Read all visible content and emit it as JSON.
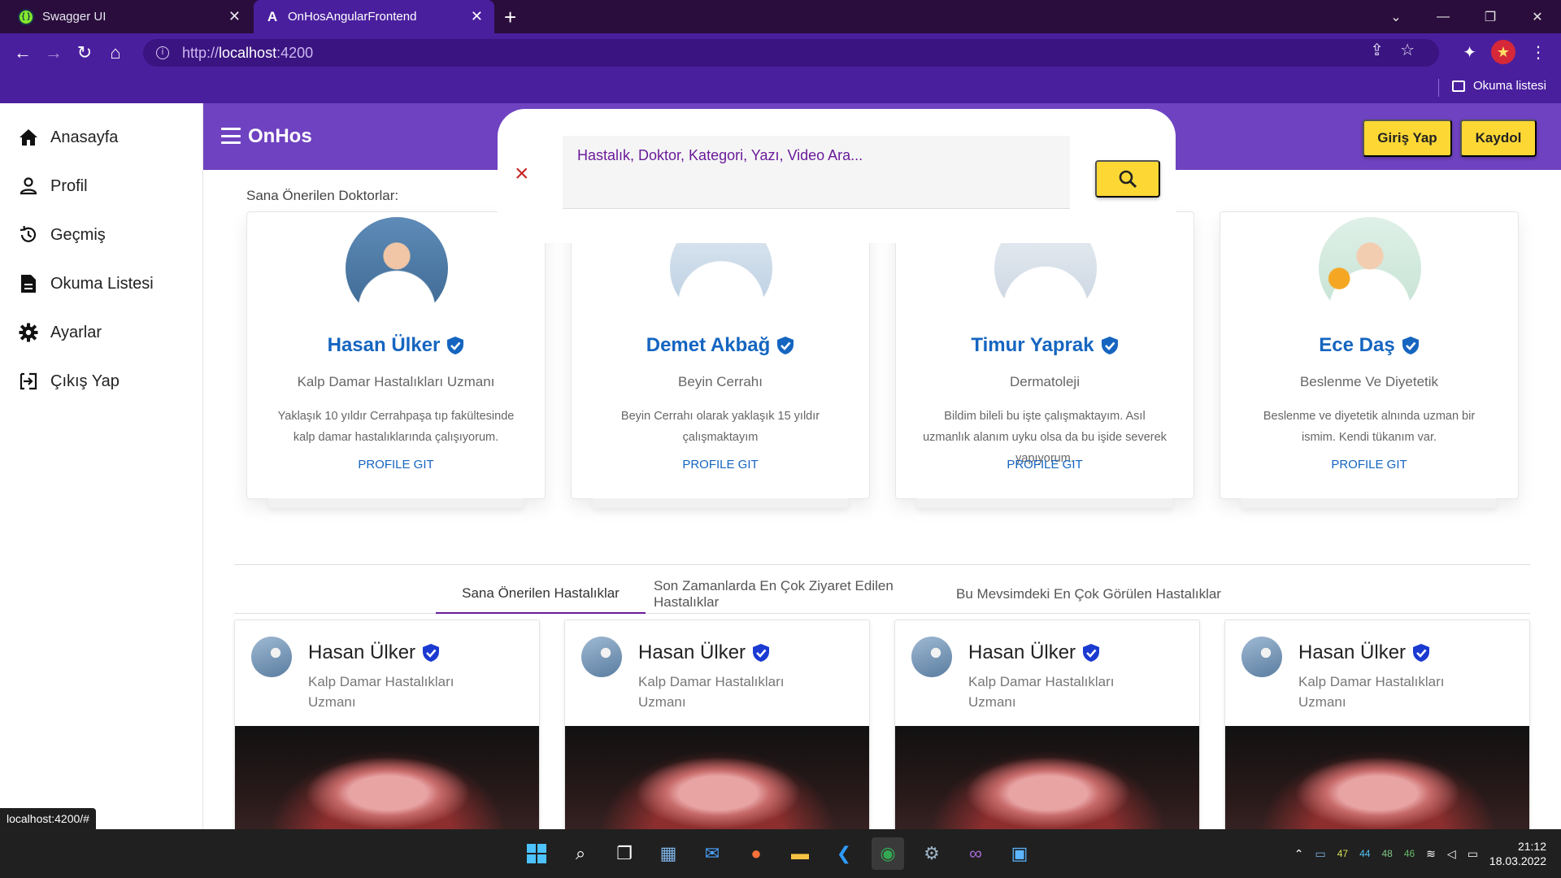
{
  "browser": {
    "tabs": [
      {
        "title": "Swagger UI",
        "favicon": "swagger-favicon",
        "active": false
      },
      {
        "title": "OnHosAngularFrontend",
        "favicon": "angular-favicon",
        "active": true
      }
    ],
    "new_tab_glyph": "+",
    "window_controls": {
      "minimize": "—",
      "restore": "❐",
      "close": "✕",
      "tab_search": "⌄"
    },
    "url": {
      "protocol": "http://",
      "host": "localhost",
      "port": ":4200"
    },
    "reading_list_label": "Okuma listesi",
    "theme_color": "#4a1f9e"
  },
  "sidebar": {
    "items": [
      {
        "label": "Anasayfa",
        "icon": "home-icon"
      },
      {
        "label": "Profil",
        "icon": "person-icon"
      },
      {
        "label": "Geçmiş",
        "icon": "history-icon"
      },
      {
        "label": "Okuma Listesi",
        "icon": "document-icon"
      },
      {
        "label": "Ayarlar",
        "icon": "gear-icon"
      },
      {
        "label": "Çıkış Yap",
        "icon": "logout-icon"
      }
    ]
  },
  "appbar": {
    "brand": "OnHos",
    "login_label": "Giriş Yap",
    "register_label": "Kaydol",
    "color": "#6f42c1",
    "button_color": "#fdd835"
  },
  "search": {
    "placeholder": "Hastalık, Doktor, Kategori, Yazı, Video Ara..."
  },
  "recommended_doctors": {
    "heading": "Sana Önerilen Doktorlar:",
    "cards": [
      {
        "name": "Hasan Ülker",
        "specialty": "Kalp Damar Hastalıkları Uzmanı",
        "description": "Yaklaşık 10 yıldır Cerrahpaşa tıp fakültesinde kalp damar hastalıklarında çalışıyorum.",
        "link": "PROFILE GIT"
      },
      {
        "name": "Demet Akbağ",
        "specialty": "Beyin Cerrahı",
        "description": "Beyin Cerrahı olarak yaklaşık 15 yıldır çalışmaktayım",
        "link": "PROFILE GIT"
      },
      {
        "name": "Timur Yaprak",
        "specialty": "Dermatoleji",
        "description": "Bildim bileli bu işte çalışmaktayım. Asıl uzmanlık alanım uyku olsa da bu işide severek yapıyorum.",
        "link": "PROFILE GIT"
      },
      {
        "name": "Ece Daş",
        "specialty": "Beslenme Ve Diyetetik",
        "description": "Beslenme ve diyetetik alnında uzman bir ismim. Kendi tükanım var.",
        "link": "PROFILE GIT"
      }
    ]
  },
  "disease_tabs": [
    {
      "label": "Sana Önerilen Hastalıklar",
      "active": true
    },
    {
      "label": "Son Zamanlarda En Çok Ziyaret Edilen Hastalıklar",
      "active": false
    },
    {
      "label": "Bu Mevsimdeki En Çok Görülen Hastalıklar",
      "active": false
    }
  ],
  "disease_cards": [
    {
      "author": "Hasan Ülker",
      "specialty": "Kalp Damar Hastalıkları Uzmanı"
    },
    {
      "author": "Hasan Ülker",
      "specialty": "Kalp Damar Hastalıkları Uzmanı"
    },
    {
      "author": "Hasan Ülker",
      "specialty": "Kalp Damar Hastalıkları Uzmanı"
    },
    {
      "author": "Hasan Ülker",
      "specialty": "Kalp Damar Hastalıkları Uzmanı"
    }
  ],
  "status_bar_url": "localhost:4200/#",
  "taskbar": {
    "apps": [
      "start-icon",
      "search-icon",
      "task-view-icon",
      "photos-icon",
      "mail-icon",
      "firefox-icon",
      "file-explorer-icon",
      "vscode-icon",
      "chrome-icon",
      "settings-icon",
      "visual-studio-icon",
      "control-panel-icon"
    ],
    "tray_numbers": [
      "47",
      "44",
      "48",
      "46"
    ],
    "time": "21:12",
    "date": "18.03.2022"
  }
}
